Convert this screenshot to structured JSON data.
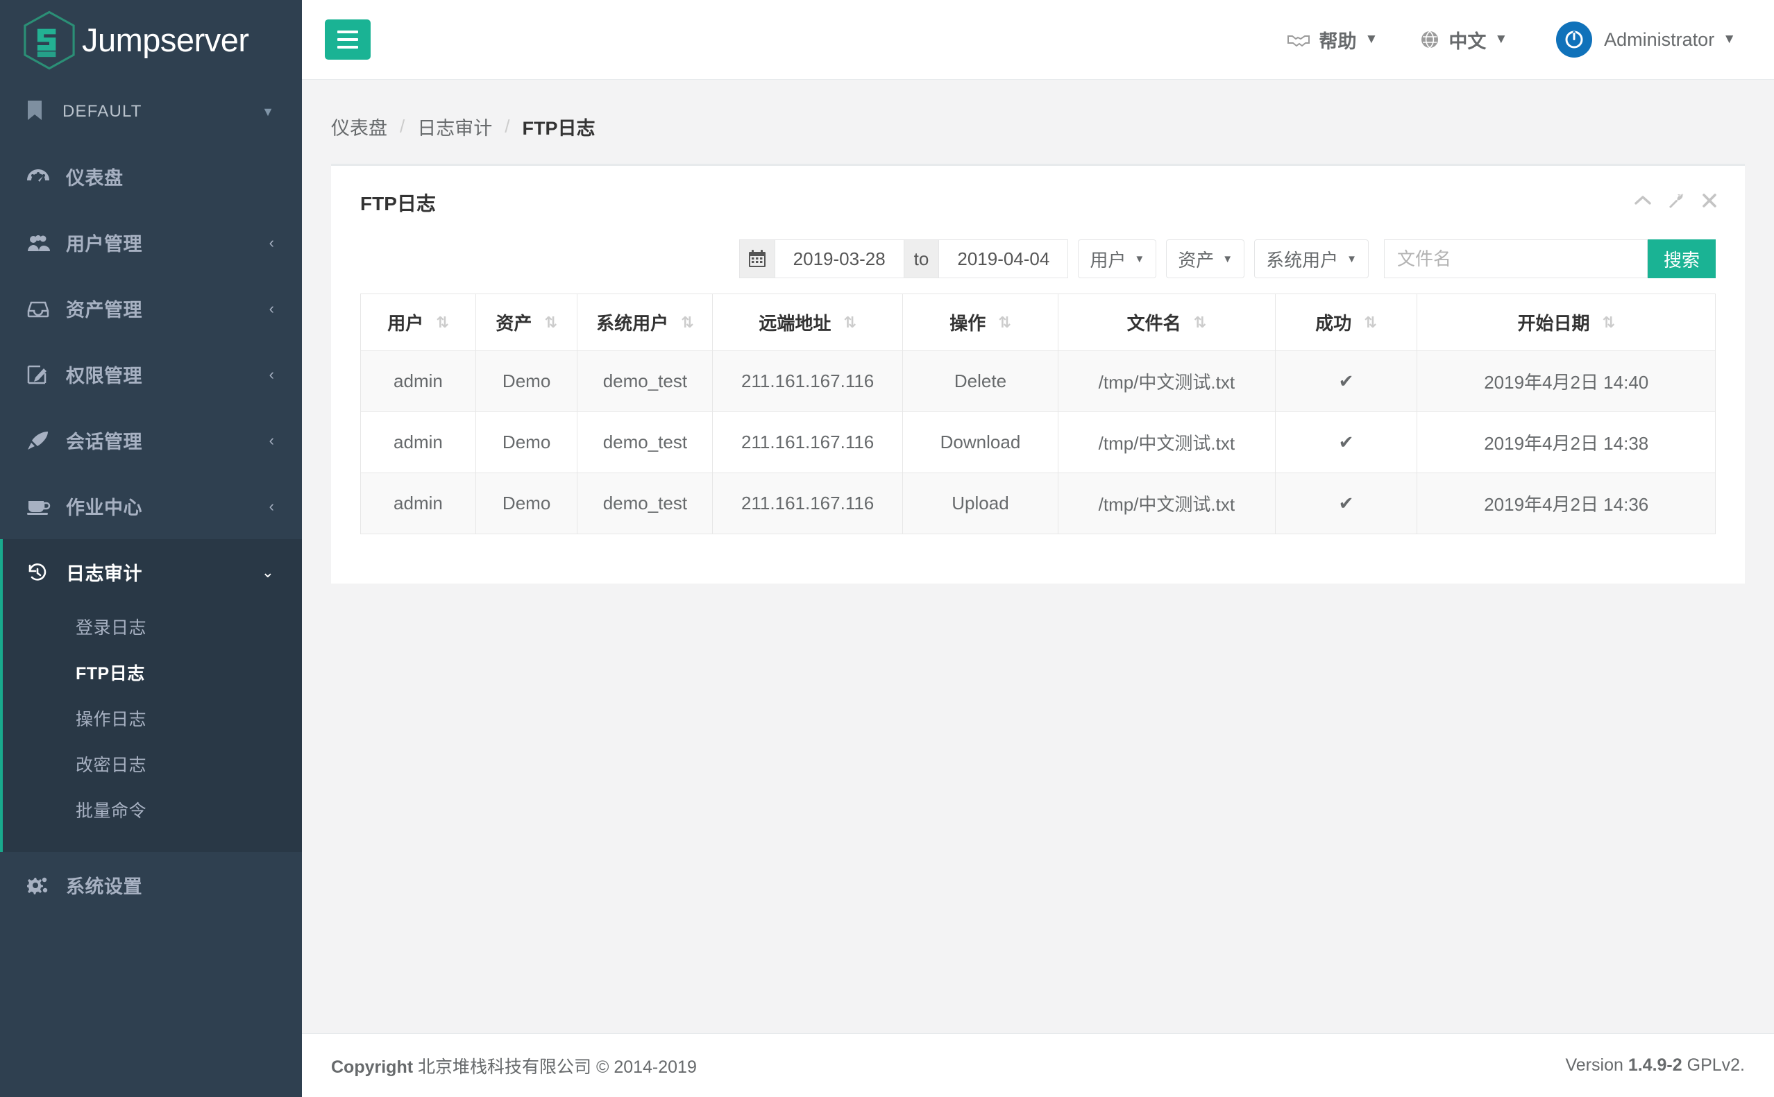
{
  "brand": {
    "name": "Jumpserver",
    "logo_icon": "jumpserver-hex-logo"
  },
  "sidebar": {
    "profile": {
      "label": "DEFAULT",
      "icon": "bookmark-icon",
      "caret": "chevron-down-icon"
    },
    "items": [
      {
        "label": "仪表盘",
        "icon": "dashboard-icon",
        "has_caret": false
      },
      {
        "label": "用户管理",
        "icon": "users-icon",
        "has_caret": true
      },
      {
        "label": "资产管理",
        "icon": "inbox-icon",
        "has_caret": true
      },
      {
        "label": "权限管理",
        "icon": "edit-square-icon",
        "has_caret": true
      },
      {
        "label": "会话管理",
        "icon": "rocket-icon",
        "has_caret": true
      },
      {
        "label": "作业中心",
        "icon": "coffee-icon",
        "has_caret": true
      }
    ],
    "active_group": {
      "label": "日志审计",
      "icon": "history-icon",
      "caret": "chevron-down-icon",
      "sub_items": [
        {
          "label": "登录日志",
          "active": false
        },
        {
          "label": "FTP日志",
          "active": true
        },
        {
          "label": "操作日志",
          "active": false
        },
        {
          "label": "改密日志",
          "active": false
        },
        {
          "label": "批量命令",
          "active": false
        }
      ]
    },
    "settings": {
      "label": "系统设置",
      "icon": "gears-icon"
    }
  },
  "topbar": {
    "menu_toggle_icon": "hamburger-icon",
    "help": {
      "label": "帮助",
      "icon": "handshake-icon",
      "caret": "caret-down-icon"
    },
    "language": {
      "label": "中文",
      "icon": "globe-icon",
      "caret": "caret-down-icon"
    },
    "user": {
      "label": "Administrator",
      "icon": "power-avatar-icon",
      "caret": "caret-down-icon"
    }
  },
  "breadcrumb": {
    "items": [
      "仪表盘",
      "日志审计",
      "FTP日志"
    ],
    "separator": "/"
  },
  "panel": {
    "title": "FTP日志",
    "tools": [
      {
        "name": "collapse-icon",
        "glyph": "chevron-up"
      },
      {
        "name": "wrench-icon",
        "glyph": "wrench"
      },
      {
        "name": "close-icon",
        "glyph": "times"
      }
    ]
  },
  "filters": {
    "calendar_icon": "calendar-icon",
    "date_from": "2019-03-28",
    "date_to": "2019-04-04",
    "date_sep_label": "to",
    "dropdowns": [
      {
        "label": "用户"
      },
      {
        "label": "资产"
      },
      {
        "label": "系统用户"
      }
    ],
    "search_placeholder": "文件名",
    "search_value": "",
    "search_button": "搜索"
  },
  "table": {
    "columns": [
      {
        "label": "用户",
        "sortable": true
      },
      {
        "label": "资产",
        "sortable": true
      },
      {
        "label": "系统用户",
        "sortable": true
      },
      {
        "label": "远端地址",
        "sortable": true
      },
      {
        "label": "操作",
        "sortable": true
      },
      {
        "label": "文件名",
        "sortable": true
      },
      {
        "label": "成功",
        "sortable": true
      },
      {
        "label": "开始日期",
        "sortable": true
      }
    ],
    "rows": [
      {
        "user": "admin",
        "asset": "Demo",
        "system_user": "demo_test",
        "remote_addr": "211.161.167.116",
        "operation": "Delete",
        "filename": "/tmp/中文测试.txt",
        "success": "✔",
        "date": "2019年4月2日 14:40"
      },
      {
        "user": "admin",
        "asset": "Demo",
        "system_user": "demo_test",
        "remote_addr": "211.161.167.116",
        "operation": "Download",
        "filename": "/tmp/中文测试.txt",
        "success": "✔",
        "date": "2019年4月2日 14:38"
      },
      {
        "user": "admin",
        "asset": "Demo",
        "system_user": "demo_test",
        "remote_addr": "211.161.167.116",
        "operation": "Upload",
        "filename": "/tmp/中文测试.txt",
        "success": "✔",
        "date": "2019年4月2日 14:36"
      }
    ]
  },
  "footer": {
    "copyright_prefix": "Copyright",
    "copyright_text": "北京堆栈科技有限公司 © 2014-2019",
    "version_prefix": "Version",
    "version_value": "1.4.9-2",
    "version_suffix": "GPLv2."
  },
  "colors": {
    "sidebar_bg": "#2f4050",
    "sidebar_active_bg": "#293846",
    "accent": "#1ab394",
    "accent_dark": "#19aa8d",
    "avatar_blue": "#1072ba",
    "body_bg": "#f3f3f4",
    "text": "#676a6c"
  }
}
